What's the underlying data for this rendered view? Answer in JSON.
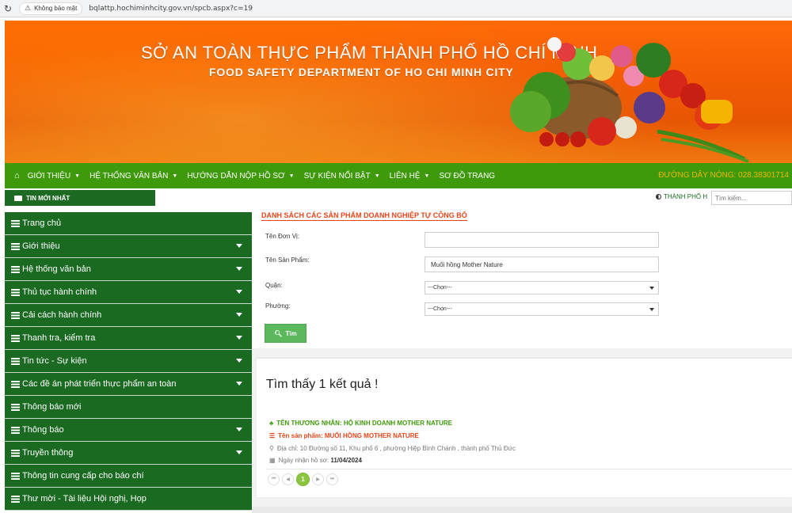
{
  "browser": {
    "security_label": "Không bảo mật",
    "url": "bqlattp.hochiminhcity.gov.vn/spcb.aspx?c=19"
  },
  "banner": {
    "title": "SỞ AN TOÀN THỰC PHẨM THÀNH PHỐ HỒ CHÍ MINH",
    "subtitle": "FOOD SAFETY DEPARTMENT OF HO CHI MINH CITY"
  },
  "topnav": {
    "items": [
      {
        "label": "GIỚI THIỆU",
        "dropdown": true
      },
      {
        "label": "HỆ THỐNG VĂN BẢN",
        "dropdown": true
      },
      {
        "label": "HƯỚNG DẪN NỘP HỒ SƠ",
        "dropdown": true
      },
      {
        "label": "SỰ KIỆN NỔI BẬT",
        "dropdown": true
      },
      {
        "label": "LIÊN HỆ",
        "dropdown": true
      },
      {
        "label": "SƠ ĐỒ TRANG",
        "dropdown": false
      }
    ],
    "hotline": "ĐƯỜNG DÂY NÓNG: 028.38301714"
  },
  "ticker": {
    "label": "TIN MỚI NHẤT",
    "city_label": "THÀNH PHỐ H",
    "search_placeholder": "Tìm kiếm..."
  },
  "sidebar": {
    "items": [
      {
        "label": "Trang chủ",
        "dropdown": false
      },
      {
        "label": "Giới thiệu",
        "dropdown": true
      },
      {
        "label": "Hệ thống văn bản",
        "dropdown": true
      },
      {
        "label": "Thủ tục hành chính",
        "dropdown": true
      },
      {
        "label": "Cải cách hành chính",
        "dropdown": true
      },
      {
        "label": "Thanh tra, kiểm tra",
        "dropdown": true
      },
      {
        "label": "Tin tức - Sự kiện",
        "dropdown": true
      },
      {
        "label": "Các đề án phát triển thực phẩm an toàn",
        "dropdown": true
      },
      {
        "label": "Thông báo mới",
        "dropdown": false
      },
      {
        "label": "Thông báo",
        "dropdown": true
      },
      {
        "label": "Truyền thông",
        "dropdown": true
      },
      {
        "label": "Thông tin cung cấp cho báo chí",
        "dropdown": false
      },
      {
        "label": "Thư mời - Tài liệu Hội nghị, Họp",
        "dropdown": false
      }
    ]
  },
  "form": {
    "section_title": "DANH SÁCH CÁC SẢN PHẨM DOANH NGHIỆP TỰ CÔNG BỐ",
    "unit_label": "Tên Đơn Vị:",
    "unit_value": "",
    "product_label": "Tên Sản Phẩm:",
    "product_value": "Muối hồng Mother Nature",
    "district_label": "Quận:",
    "district_value": "---Chọn---",
    "ward_label": "Phường:",
    "ward_value": "---Chọn---",
    "search_button": "Tìm"
  },
  "results": {
    "heading": "Tìm thấy 1 kết quả !",
    "merchant": "TÊN THƯƠNG NHÂN: HỘ KINH DOANH MOTHER NATURE",
    "product": "Tên sản phẩm: MUỐI HỒNG MOTHER NATURE",
    "address": "Địa chỉ: 10 Đường số 11, Khu phố 6 , phường Hiệp Bình Chánh , thành phố Thủ Đức",
    "date_label": "Ngày nhận hồ sơ:",
    "date_value": "11/04/2024"
  },
  "pagination": {
    "first": "⏮",
    "prev": "◀",
    "current": "1",
    "next": "▶",
    "last": "⏭"
  },
  "colors": {
    "nav_green": "#3e9a0b",
    "sidebar_green": "#1a6a21",
    "accent_orange": "#e8461a",
    "banner_orange": "#f25c05",
    "hotline_yellow": "#f0b400"
  }
}
